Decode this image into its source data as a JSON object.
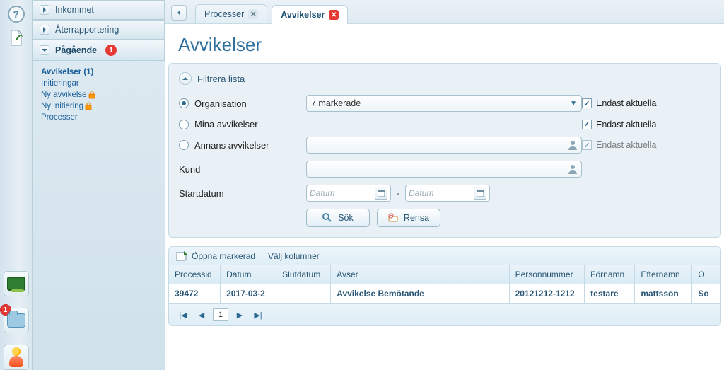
{
  "rail": {
    "help": "?",
    "folder_badge": "1"
  },
  "sidebar": {
    "heads": [
      {
        "label": "Inkommet",
        "expanded": false
      },
      {
        "label": "Återrapportering",
        "expanded": false
      },
      {
        "label": "Pågående",
        "expanded": true,
        "badge": "1"
      }
    ],
    "sub": [
      {
        "label": "Avvikelser (1)",
        "bold": true
      },
      {
        "label": "Initieringar"
      },
      {
        "label": "Ny avvikelse",
        "lock": true
      },
      {
        "label": "Ny initiering",
        "lock": true
      },
      {
        "label": "Processer"
      }
    ]
  },
  "tabs": [
    {
      "label": "Processer",
      "active": false,
      "close": "gray"
    },
    {
      "label": "Avvikelser",
      "active": true,
      "close": "red"
    }
  ],
  "page": {
    "title": "Avvikelser"
  },
  "filter": {
    "title": "Filtrera lista",
    "org_label": "Organisation",
    "mine_label": "Mina avvikelser",
    "other_label": "Annans avvikelser",
    "kund_label": "Kund",
    "startdatum_label": "Startdatum",
    "org_value": "7 markerade",
    "date_ph": "Datum",
    "only_current": "Endast aktuella",
    "search": "Sök",
    "clear": "Rensa"
  },
  "toolbar": {
    "open": "Öppna markerad",
    "columns": "Välj kolumner"
  },
  "grid": {
    "headers": {
      "processid": "Processid",
      "datum": "Datum",
      "slutdatum": "Slutdatum",
      "avser": "Avser",
      "person": "Personnummer",
      "fornamn": "Förnamn",
      "efternamn": "Efternamn",
      "org": "O"
    },
    "rows": [
      {
        "processid": "39472",
        "datum": "2017-03-2",
        "slutdatum": "",
        "avser": "Avvikelse Bemötande",
        "person": "20121212-1212",
        "fornamn": "testare",
        "efternamn": "mattsson",
        "org": "So"
      }
    ]
  },
  "pager": {
    "page": "1"
  }
}
